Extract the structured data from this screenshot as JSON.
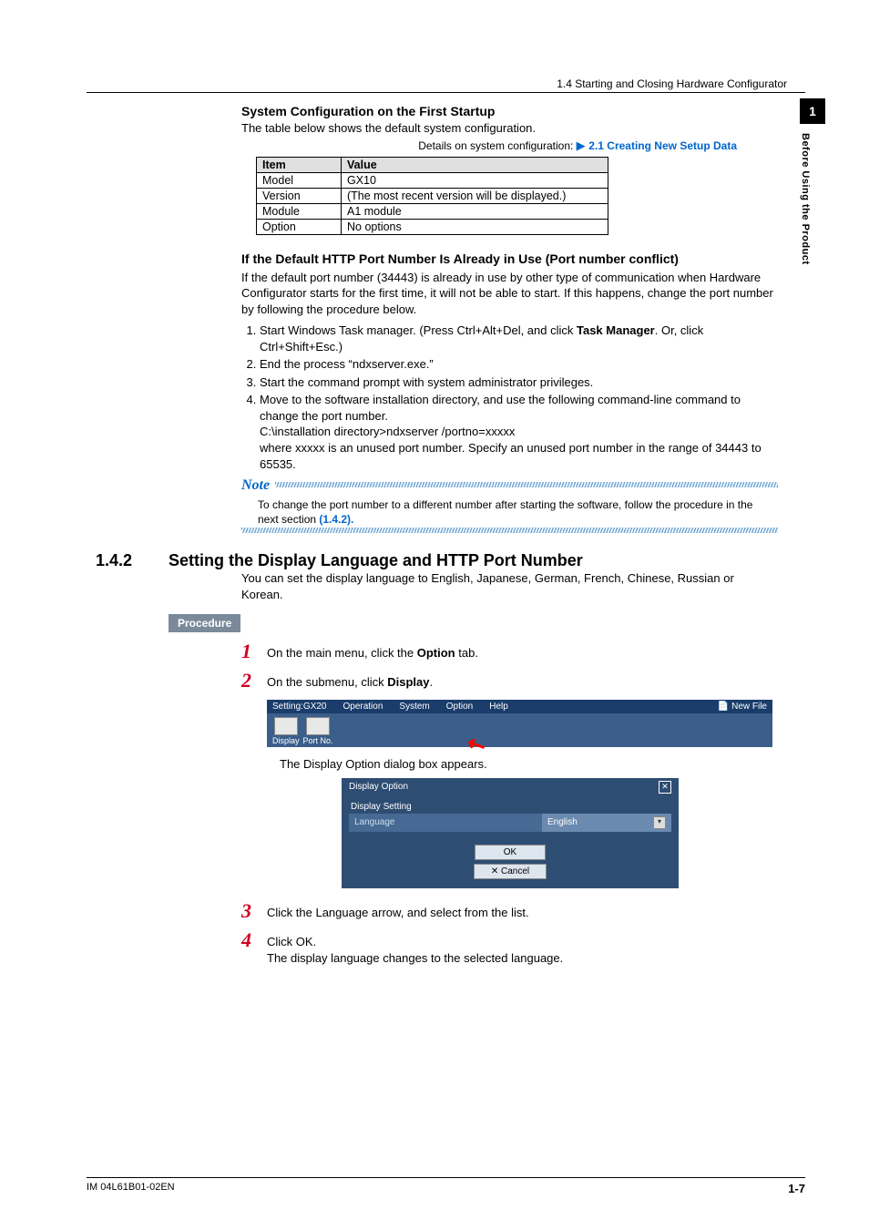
{
  "header": {
    "breadcrumb": "1.4  Starting and Closing Hardware Configurator"
  },
  "sidetab": {
    "chapter": "1",
    "title": "Before Using the Product"
  },
  "s1": {
    "title": "System Configuration on the First Startup",
    "intro": "The table below shows the default system configuration.",
    "details_prefix": "Details on system configuration: ",
    "details_link": "2.1 Creating New Setup Data",
    "table": {
      "head_item": "Item",
      "head_value": "Value",
      "rows": [
        {
          "k": "Model",
          "v": "GX10"
        },
        {
          "k": "Version",
          "v": "(The most recent version will be displayed.)"
        },
        {
          "k": "Module",
          "v": "A1 module"
        },
        {
          "k": "Option",
          "v": "No options"
        }
      ]
    }
  },
  "s2": {
    "title": "If the Default HTTP Port Number Is Already in Use (Port number conflict)",
    "intro": "If the default port number (34443) is already in use by other type of communication when Hardware Configurator starts for the first time, it will not be able to start. If this happens, change the port number by following the procedure below.",
    "li1a": "Start Windows Task manager. (Press Ctrl+Alt+Del, and click ",
    "li1b": "Task Manager",
    "li1c": ". Or, click Ctrl+Shift+Esc.)",
    "li2": "End the process “ndxserver.exe.”",
    "li3": "Start the command prompt with system administrator privileges.",
    "li4": "Move to the software installation directory, and use the following command-line command to change the port number.",
    "li4b": "C:\\installation directory>ndxserver /portno=xxxxx",
    "li4c": "where xxxxx is an unused port number. Specify an unused port number in the range of 34443 to 65535.",
    "note_label": "Note",
    "note_body_a": "To change the port number to a different number after starting the software, follow the procedure in the next section ",
    "note_body_b": "(1.4.2)."
  },
  "s3": {
    "num": "1.4.2",
    "title": "Setting the Display Language and HTTP Port Number",
    "intro": "You can set the display language to English, Japanese, German, French, Chinese, Russian or Korean.",
    "procedure_label": "Procedure",
    "step1a": "On the main menu, click the ",
    "step1b": "Option",
    "step1c": " tab.",
    "step2a": "On the submenu, click ",
    "step2b": "Display",
    "step2c": ".",
    "ui_menu": {
      "m1": "Setting:GX20",
      "m2": "Operation",
      "m3": "System",
      "m4": "Option",
      "m5": "Help",
      "newfile": "New File",
      "r1": "Display",
      "r2": "Port No."
    },
    "caption1": "The Display Option dialog box appears.",
    "dialog": {
      "title": "Display Option",
      "section": "Display Setting",
      "label": "Language",
      "value": "English",
      "ok": "OK",
      "cancel": "Cancel"
    },
    "step3": "Click the Language arrow, and select from the list.",
    "step4a": "Click OK.",
    "step4b": "The display language changes to the selected language."
  },
  "footer": {
    "doc": "IM 04L61B01-02EN",
    "page": "1-7"
  },
  "steps": {
    "n1": "1",
    "n2": "2",
    "n3": "3",
    "n4": "4"
  }
}
